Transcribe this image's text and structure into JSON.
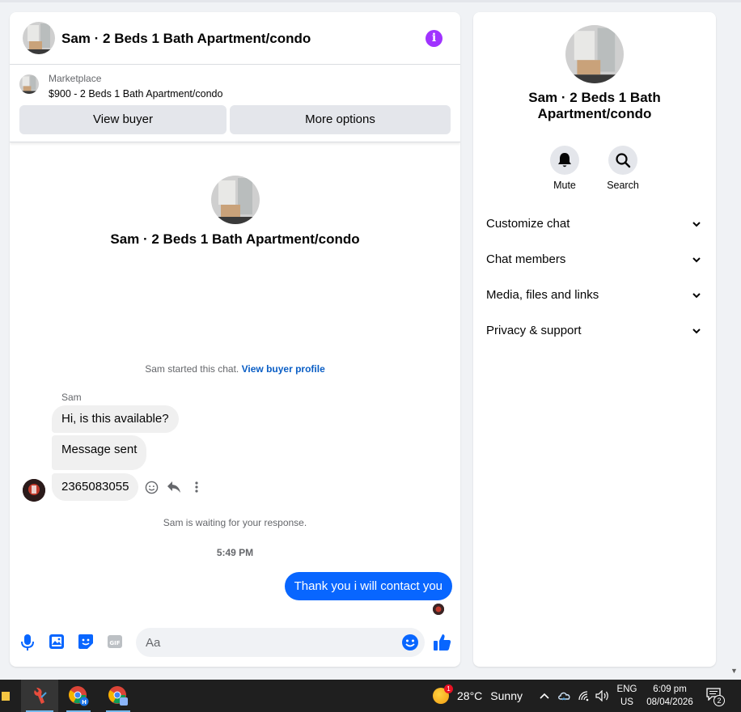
{
  "chat": {
    "header_title": "Sam · 2 Beds 1 Bath Apartment/condo",
    "listing": {
      "source": "Marketplace",
      "price_title": "$900 - 2 Beds 1 Bath Apartment/condo",
      "view_buyer_label": "View buyer",
      "more_options_label": "More options"
    },
    "intro_title": "Sam · 2 Beds 1 Bath Apartment/condo",
    "started_text": "Sam started this chat.",
    "started_link": "View buyer profile",
    "sender_name": "Sam",
    "messages_in": [
      {
        "text": "Hi, is this available?"
      },
      {
        "text": "Message sent"
      },
      {
        "text": "2365083055"
      }
    ],
    "waiting_text": "Sam is waiting for your response.",
    "timestamp": "5:49 PM",
    "message_out": "Thank you i will contact you",
    "composer_placeholder": "Aa",
    "accent_color": "#0866ff"
  },
  "side": {
    "title": "Sam · 2 Beds 1 Bath Apartment/condo",
    "actions": [
      {
        "label": "Mute",
        "icon": "bell-icon"
      },
      {
        "label": "Search",
        "icon": "search-icon"
      }
    ],
    "menu": [
      {
        "label": "Customize chat"
      },
      {
        "label": "Chat members"
      },
      {
        "label": "Media, files and links"
      },
      {
        "label": "Privacy & support"
      }
    ]
  },
  "taskbar": {
    "weather_temp": "28°C",
    "weather_desc": "Sunny",
    "weather_badge": "1",
    "lang_top": "ENG",
    "lang_bottom": "US",
    "time": "6:09 pm",
    "date": "08/04/2026",
    "notif_count": "2",
    "chrome_profile_letter": "H"
  }
}
